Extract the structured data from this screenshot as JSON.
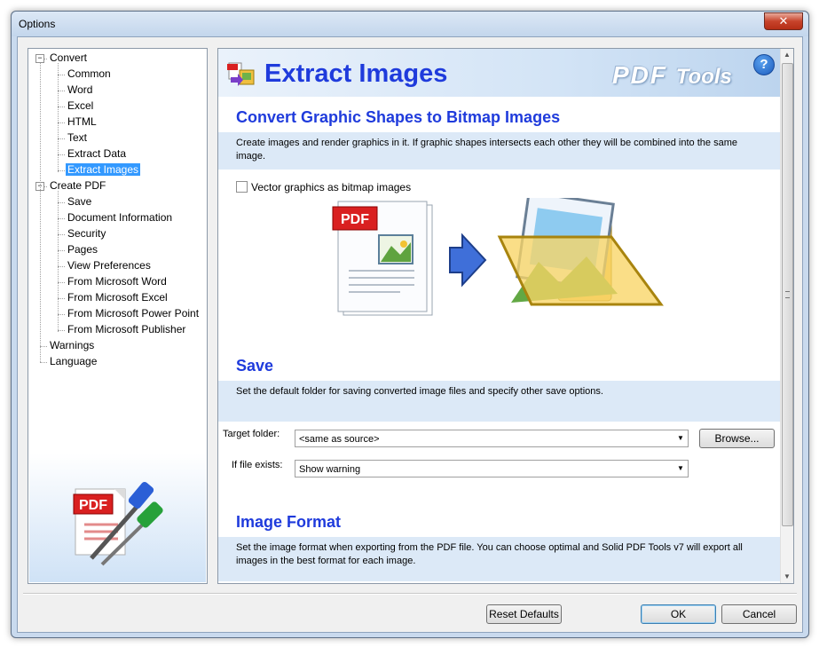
{
  "window": {
    "title": "Options",
    "close_glyph": "✕"
  },
  "tree": {
    "items": [
      {
        "label": "Convert",
        "level": 0,
        "expander": "−"
      },
      {
        "label": "Common",
        "level": 1
      },
      {
        "label": "Word",
        "level": 1
      },
      {
        "label": "Excel",
        "level": 1
      },
      {
        "label": "HTML",
        "level": 1
      },
      {
        "label": "Text",
        "level": 1
      },
      {
        "label": "Extract Data",
        "level": 1
      },
      {
        "label": "Extract Images",
        "level": 1,
        "selected": true
      },
      {
        "label": "Create PDF",
        "level": 0,
        "expander": "−"
      },
      {
        "label": "Save",
        "level": 1
      },
      {
        "label": "Document Information",
        "level": 1
      },
      {
        "label": "Security",
        "level": 1
      },
      {
        "label": "Pages",
        "level": 1
      },
      {
        "label": "View Preferences",
        "level": 1
      },
      {
        "label": "From Microsoft Word",
        "level": 1
      },
      {
        "label": "From Microsoft Excel",
        "level": 1
      },
      {
        "label": "From Microsoft Power Point",
        "level": 1
      },
      {
        "label": "From Microsoft Publisher",
        "level": 1
      },
      {
        "label": "Warnings",
        "level": 0
      },
      {
        "label": "Language",
        "level": 0
      }
    ],
    "logo_text": "PDF"
  },
  "panel": {
    "title": "Extract Images",
    "brand_main": "PDF",
    "brand_sub": "Tools",
    "help_glyph": "?",
    "sections": {
      "convert": {
        "title": "Convert Graphic Shapes to Bitmap Images",
        "description": "Create images and render graphics in it. If graphic shapes intersects each other they will be combined into the same image.",
        "checkbox_label": "Vector graphics as bitmap images",
        "checkbox_checked": false,
        "pdf_badge": "PDF"
      },
      "save": {
        "title": "Save",
        "description": "Set the default folder for saving converted image files and specify other save options.",
        "target_folder_label": "Target folder:",
        "target_folder_value": "<same as source>",
        "browse_label": "Browse...",
        "if_exists_label": "If file exists:",
        "if_exists_value": "Show warning"
      },
      "format": {
        "title": "Image Format",
        "description": "Set the image format when exporting from the PDF file. You can choose optimal and Solid PDF Tools v7 will export all images in the best format for each image."
      }
    }
  },
  "footer": {
    "reset_label": "Reset Defaults",
    "ok_label": "OK",
    "cancel_label": "Cancel"
  },
  "colors": {
    "heading": "#1f3bdc",
    "selection": "#3399ff",
    "desc_band": "#dce9f7"
  }
}
